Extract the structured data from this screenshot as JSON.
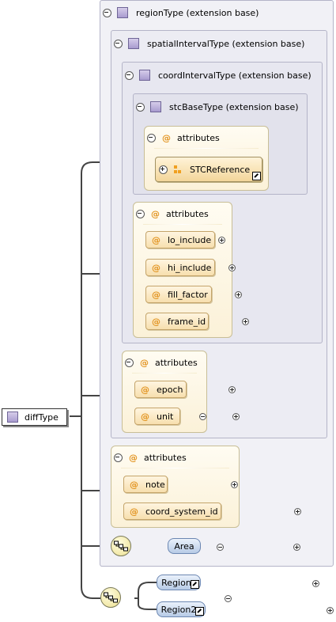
{
  "root": {
    "label": "diffType",
    "icon": "complex-type-icon"
  },
  "regionType": {
    "label": "regionType (extension base)"
  },
  "spatialIntervalType": {
    "label": "spatialIntervalType (extension base)"
  },
  "coordIntervalType": {
    "label": "coordIntervalType (extension base)"
  },
  "stcBaseType": {
    "label": "stcBaseType (extension base)",
    "attributes_label": "attributes",
    "ref": "STCReference"
  },
  "coordIntervalAttrs": {
    "label": "attributes",
    "items": [
      "lo_include",
      "hi_include",
      "fill_factor",
      "frame_id"
    ]
  },
  "spatialIntervalAttrs": {
    "label": "attributes",
    "items": [
      "epoch",
      "unit"
    ]
  },
  "regionAttrs": {
    "label": "attributes",
    "items": [
      "note",
      "coord_system_id"
    ]
  },
  "regionSequence": {
    "element": "Area"
  },
  "diffSequence": {
    "elements": [
      "Region",
      "Region2"
    ]
  },
  "attr_symbol": "@",
  "colors": {
    "attribute_fill": "#f7dfae",
    "element_fill": "#b7cbe6",
    "extension_fill": "#f1f1f6",
    "sequence_fill": "#ecdf90"
  }
}
